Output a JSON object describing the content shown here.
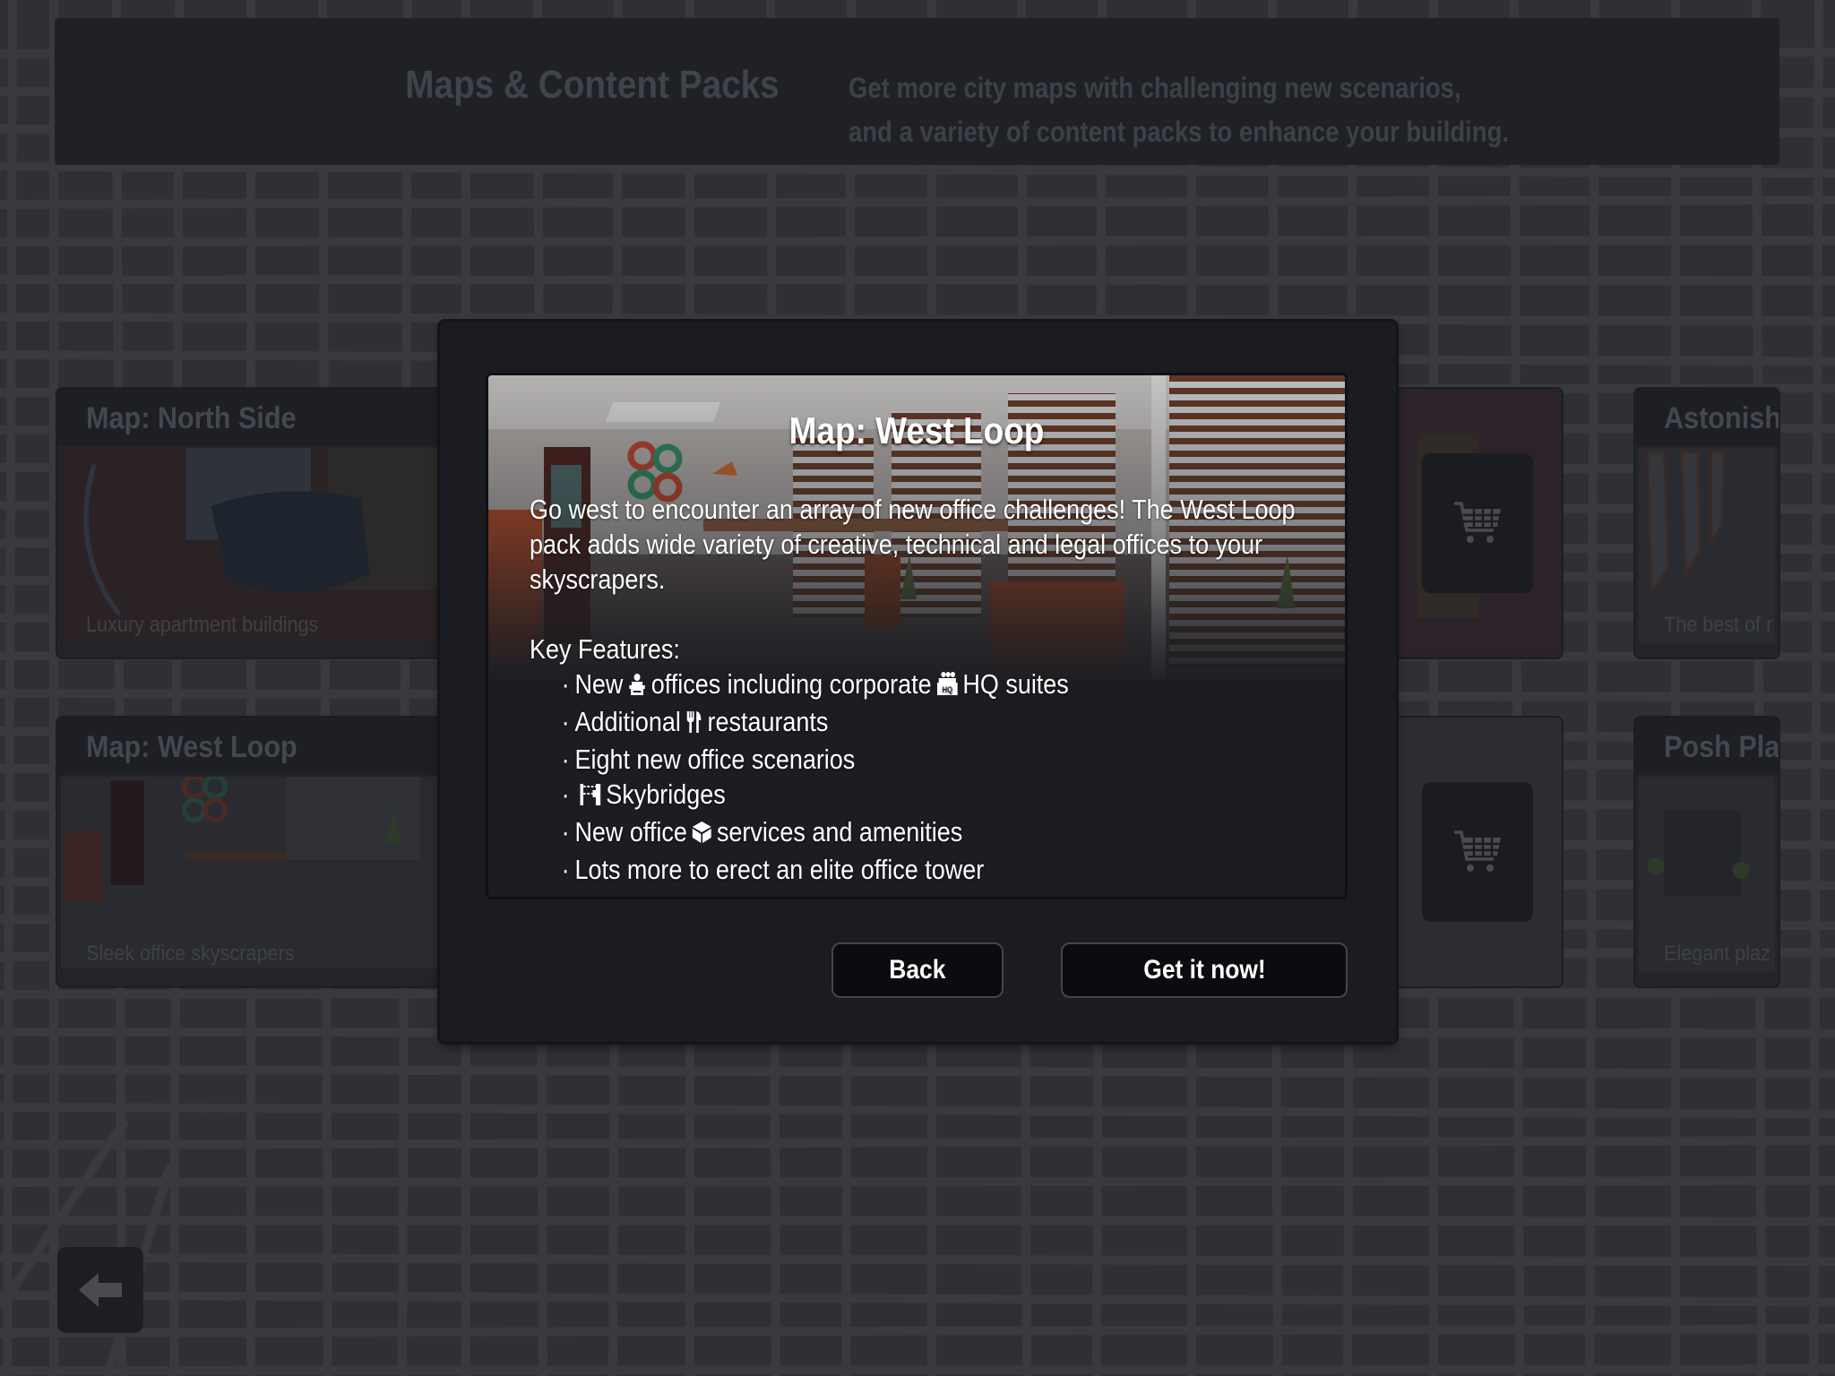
{
  "header": {
    "title": "Maps & Content Packs",
    "subtitle_line1": "Get more city maps with challenging new scenarios,",
    "subtitle_line2": "and a variety of content packs to enhance your building."
  },
  "cards": [
    {
      "title": "Map: North Side",
      "description": "Luxury apartment buildings"
    },
    {
      "title": "Map: West Loop",
      "description": "Sleek office skyscrapers"
    },
    {
      "title": "Astonish",
      "description": "The best of r"
    },
    {
      "title": "Posh Pla",
      "description": "Elegant plaz"
    }
  ],
  "cart_buttons": [
    {
      "icon": "shopping-cart-icon"
    },
    {
      "icon": "shopping-cart-icon"
    }
  ],
  "nav": {
    "back_icon": "arrow-left-icon"
  },
  "modal": {
    "title": "Map: West Loop",
    "description": "Go west to encounter an array of new office challenges! The West Loop pack adds wide variety of creative, technical and legal offices to your skyscrapers.",
    "key_features_label": "Key Features:",
    "bullet": "·",
    "features": [
      {
        "before": "New",
        "icon": "office-desk-icon",
        "after": "offices including corporate",
        "icon2": "hq-suite-icon",
        "after2": "HQ suites"
      },
      {
        "before": "Additional",
        "icon": "fork-knife-icon",
        "after": "restaurants"
      },
      {
        "before": "Eight new office scenarios"
      },
      {
        "before": "",
        "icon": "skybridge-icon",
        "after": "Skybridges"
      },
      {
        "before": "New office",
        "icon": "package-box-icon",
        "after": "services and amenities"
      },
      {
        "before": "Lots more to erect an elite office tower"
      }
    ],
    "buttons": {
      "back": "Back",
      "get": "Get it now!"
    }
  },
  "colors": {
    "background": "#2f3036",
    "modal": "#1b1c21",
    "button_bg": "#0b0c0f",
    "button_border": "#45464c",
    "text_primary": "#ffffff"
  }
}
